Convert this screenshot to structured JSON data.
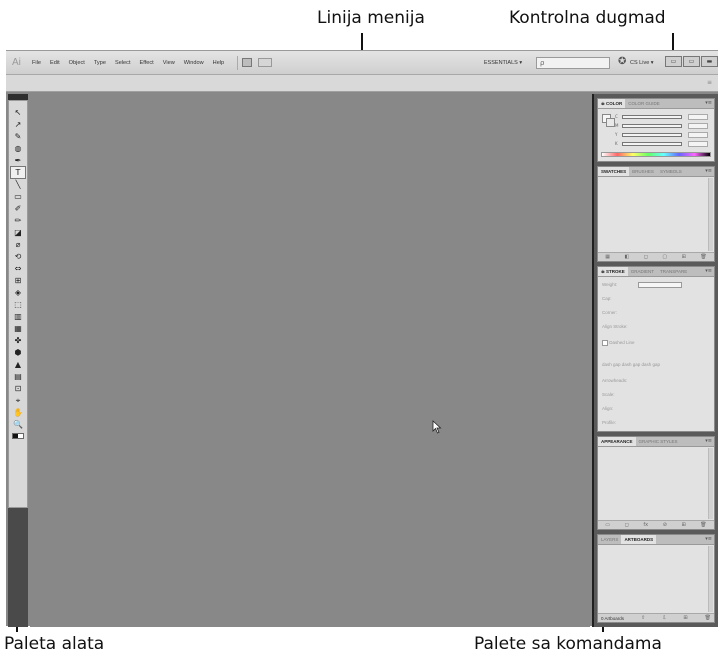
{
  "callouts": {
    "menu_bar": "Linija menija",
    "control_buttons": "Kontrolna dugmad",
    "tools_palette": "Paleta alata",
    "command_palettes": "Palete sa komandama"
  },
  "app": {
    "logo": "Ai",
    "menu": [
      "File",
      "Edit",
      "Object",
      "Type",
      "Select",
      "Effect",
      "View",
      "Window",
      "Help"
    ],
    "workspace": "ESSENTIALS ▾",
    "search_placeholder": "ρ",
    "cslive": "CS Live ▾",
    "window_controls": [
      "▭",
      "▭",
      "▬"
    ]
  },
  "icons": {
    "window_controls": [
      "minimize-icon",
      "restore-icon",
      "close-icon"
    ],
    "cslive": "cs-live-icon",
    "search": "search-icon",
    "cursor": "mouse-pointer-icon"
  },
  "tools": [
    "↖",
    "↗",
    "✎",
    "◍",
    "✒",
    "T",
    "╲",
    "▭",
    "✐",
    "✏",
    "◪",
    "⌀",
    "⟲",
    "⇔",
    "⊞",
    "◈",
    "⬚",
    "▥",
    "▦",
    "✤",
    "⬢",
    "▲",
    "▤",
    "⊡",
    "⌖",
    "✋",
    "🔍"
  ],
  "panels": {
    "color": {
      "tabs": [
        "≑ COLOR",
        "COLOR GUIDE"
      ],
      "channels": [
        "C",
        "M",
        "Y",
        "K"
      ],
      "menu": "▾≡"
    },
    "swatches": {
      "tabs": [
        "SWATCHES",
        "BRUSHES",
        "SYMBOLS"
      ],
      "menu": "▾≡"
    },
    "stroke": {
      "tabs": [
        "≑ STROKE",
        "GRADIENT",
        "TRANSPARE"
      ],
      "rows": [
        "Weight:",
        "Cap:",
        "Corner:",
        "Align Stroke:",
        "Dashed Line",
        "dash gap dash gap dash gap",
        "Arrowheads:",
        "Scale:",
        "Align:",
        "Profile:"
      ],
      "menu": "▾≡"
    },
    "appearance": {
      "tabs": [
        "APPEARANCE",
        "GRAPHIC STYLES"
      ],
      "menu": "▾≡"
    },
    "layers": {
      "tabs": [
        "LAYERS",
        "ARTBOARDS"
      ],
      "footer": "0 Artboards",
      "menu": "▾≡"
    }
  }
}
